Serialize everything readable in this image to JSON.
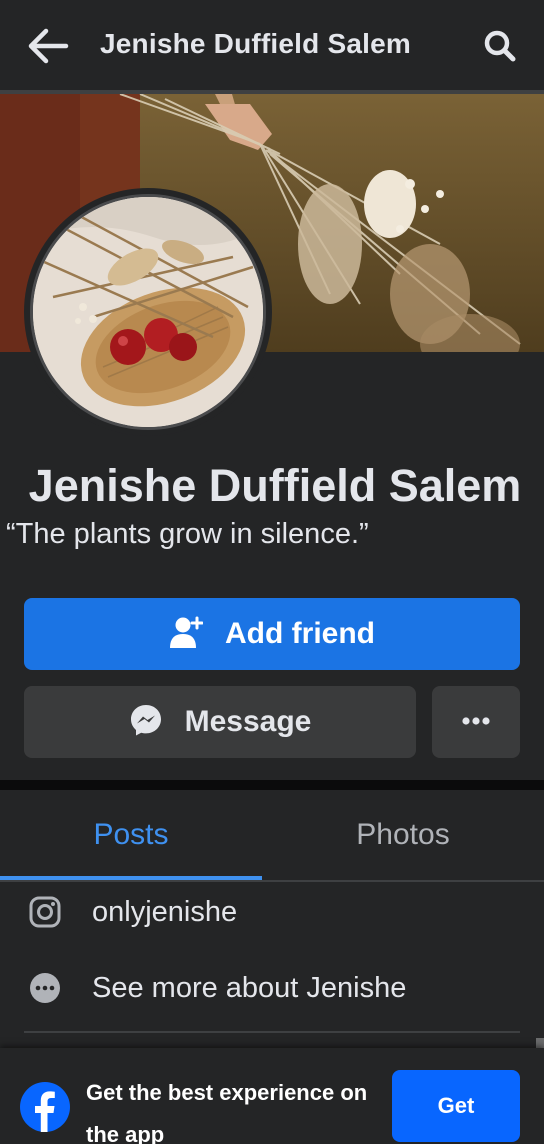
{
  "header": {
    "title": "Jenishe Duffield Salem",
    "back_icon": "arrow-left-icon",
    "search_icon": "search-icon"
  },
  "profile": {
    "name": "Jenishe Duffield Salem",
    "bio": "“The plants grow in silence.”"
  },
  "actions": {
    "add_friend_label": "Add friend",
    "message_label": "Message",
    "more_icon": "more-dots-icon"
  },
  "tabs": [
    {
      "label": "Posts",
      "active": true
    },
    {
      "label": "Photos",
      "active": false
    }
  ],
  "intro": {
    "instagram": "onlyjenishe",
    "see_more": "See more about Jenishe"
  },
  "app_banner": {
    "text": "Get the best experience on the app",
    "button_label": "Get"
  },
  "colors": {
    "background": "#242526",
    "primary": "#1b74e4",
    "tab_active": "#3f91f0",
    "secondary_button": "#3a3b3c",
    "banner_button": "#0866ff"
  }
}
